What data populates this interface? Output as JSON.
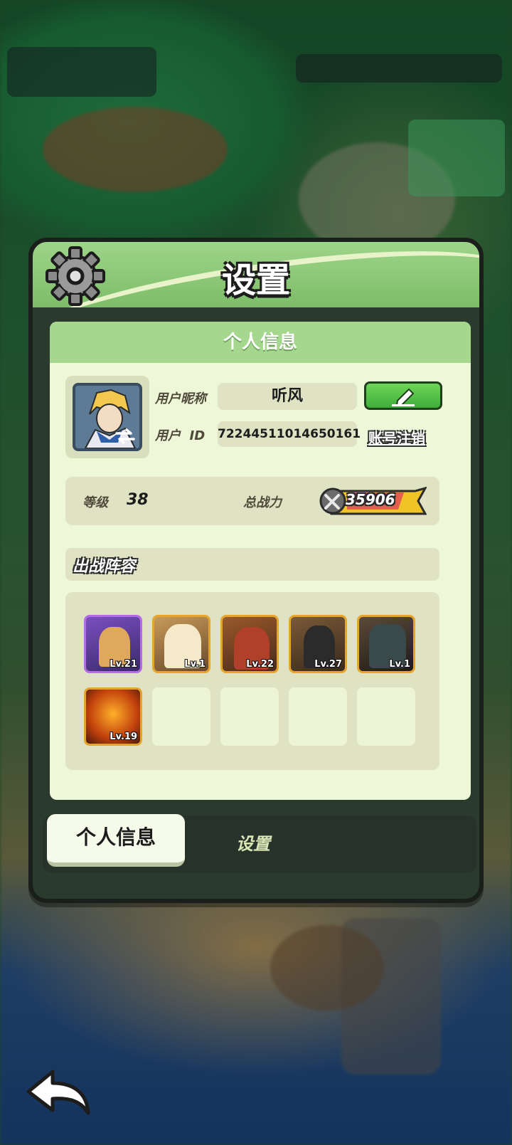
{
  "panel": {
    "title": "设置",
    "info_section_title": "个人信息"
  },
  "profile": {
    "nickname_label": "用户昵称",
    "nickname": "听风",
    "id_label": "用户  ID",
    "user_id": "72244511014650161",
    "logout_label": "账号注销"
  },
  "stats": {
    "level_label": "等级",
    "level": "38",
    "power_label": "总战力",
    "power": "35906"
  },
  "lineup": {
    "title": "出战阵容",
    "heroes": [
      {
        "level": "Lv.21",
        "color": "#5a3b8c"
      },
      {
        "level": "Lv.1",
        "color": "#b8874a"
      },
      {
        "level": "Lv.22",
        "color": "#8a3a2a"
      },
      {
        "level": "Lv.27",
        "color": "#6a4a2a"
      },
      {
        "level": "Lv.1",
        "color": "#3a3a3a"
      },
      {
        "level": "Lv.19",
        "color": "#c85a1a"
      }
    ]
  },
  "tabs": {
    "active_label": "个人信息",
    "inactive_label": "设置"
  },
  "colors": {
    "header_green": "#7dbd68",
    "card_bg": "#eef7d8",
    "edit_button": "#3fae3a",
    "power_badge": "#f0c424"
  }
}
